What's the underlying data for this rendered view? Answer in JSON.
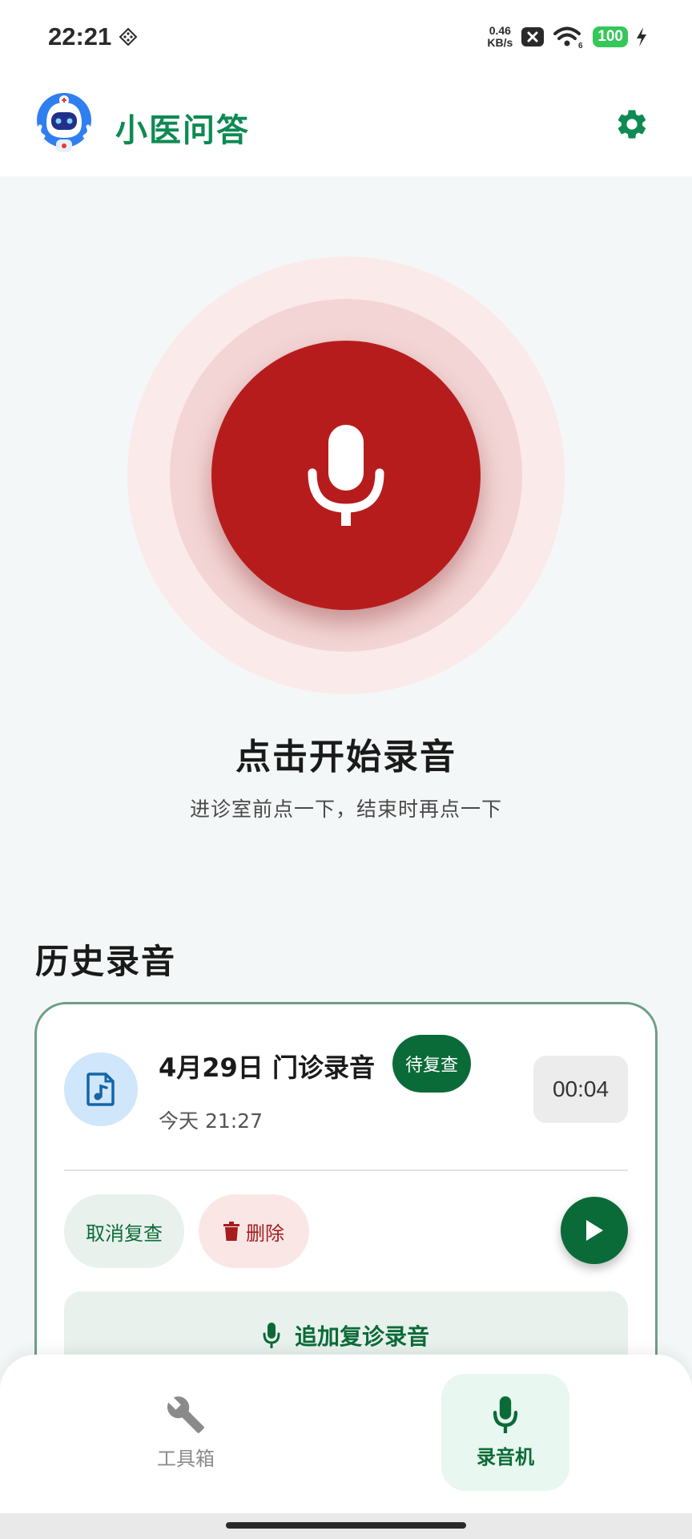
{
  "status_bar": {
    "time": "22:21",
    "net_speed_value": "0.46",
    "net_speed_unit": "KB/s",
    "battery": "100",
    "icons": [
      "location-grid-icon",
      "close-box-icon",
      "wifi-icon",
      "charging-icon"
    ]
  },
  "header": {
    "title": "小医问答",
    "avatar_icon": "robot-doctor-icon",
    "settings_icon": "gear-icon"
  },
  "recorder": {
    "title": "点击开始录音",
    "subtitle": "进诊室前点一下，结束时再点一下",
    "icon": "microphone-icon",
    "color": "#b71c1c"
  },
  "history": {
    "title": "历史录音",
    "records": [
      {
        "name": "4月29日 门诊录音",
        "badge": "待复查",
        "time": "今天 21:27",
        "duration": "00:04",
        "cancel_label": "取消复查",
        "delete_label": "删除",
        "append_label": "追加复诊录音"
      }
    ]
  },
  "bottom_nav": {
    "items": [
      {
        "label": "工具箱",
        "icon": "wrench-icon",
        "active": false
      },
      {
        "label": "录音机",
        "icon": "microphone-icon",
        "active": true
      }
    ]
  },
  "colors": {
    "brand_green": "#0e8a52",
    "dark_green": "#0b6b38",
    "record_red": "#b71c1c"
  }
}
